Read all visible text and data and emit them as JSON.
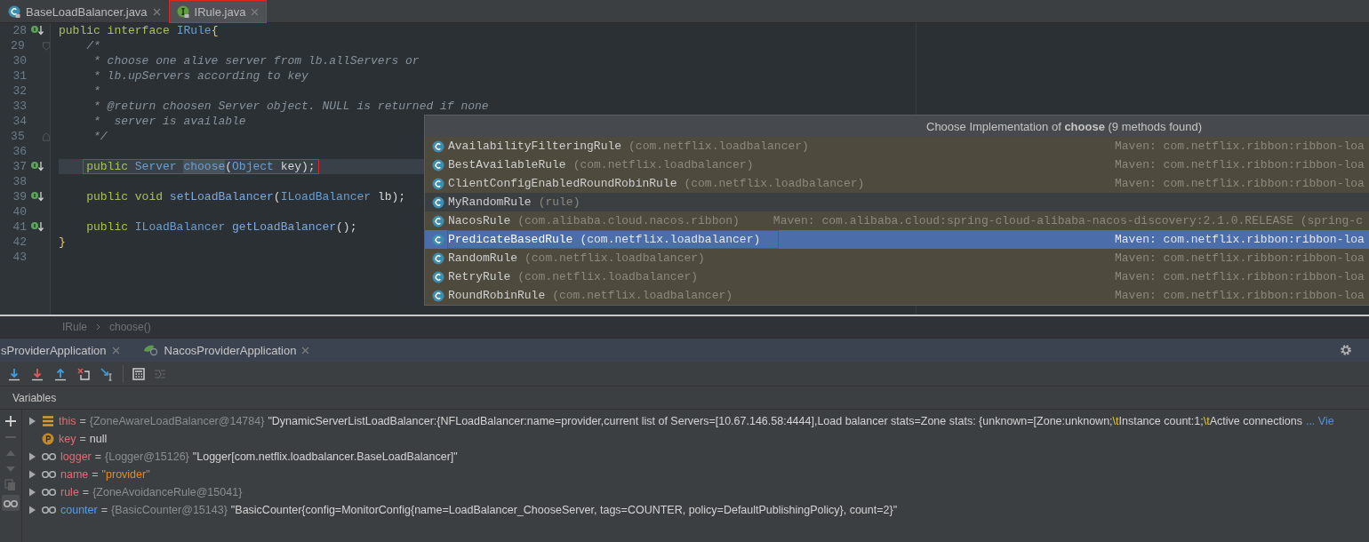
{
  "editor_tabs": [
    {
      "label": "BaseLoadBalancer.java",
      "kind": "class",
      "selected": false,
      "annotated": false
    },
    {
      "label": "IRule.java",
      "kind": "interface",
      "selected": true,
      "annotated": true
    }
  ],
  "code": {
    "lines": [
      {
        "number": "28",
        "kind": "implemented",
        "current": false,
        "annotated": false,
        "tokens": [
          {
            "text": "public interface ",
            "kind": "keyword"
          },
          {
            "text": "IRule",
            "kind": "type"
          },
          {
            "text": "{",
            "kind": "brace"
          }
        ]
      },
      {
        "number": "29",
        "kind": "fold-start",
        "current": false,
        "annotated": false,
        "tokens": [
          {
            "text": "    /*",
            "kind": "comment"
          }
        ]
      },
      {
        "number": "30",
        "kind": "plain",
        "current": false,
        "annotated": false,
        "tokens": [
          {
            "text": "     * choose one alive server from lb.allServers or",
            "kind": "comment"
          }
        ]
      },
      {
        "number": "31",
        "kind": "plain",
        "current": false,
        "annotated": false,
        "tokens": [
          {
            "text": "     * lb.upServers according to key",
            "kind": "comment"
          }
        ]
      },
      {
        "number": "32",
        "kind": "plain",
        "current": false,
        "annotated": false,
        "tokens": [
          {
            "text": "     *",
            "kind": "comment"
          }
        ]
      },
      {
        "number": "33",
        "kind": "plain",
        "current": false,
        "annotated": false,
        "tokens": [
          {
            "text": "     * @return choosen Server object. NULL is returned if none",
            "kind": "comment"
          }
        ]
      },
      {
        "number": "34",
        "kind": "plain",
        "current": false,
        "annotated": false,
        "tokens": [
          {
            "text": "     *  server is available",
            "kind": "comment"
          }
        ]
      },
      {
        "number": "35",
        "kind": "fold-end",
        "current": false,
        "annotated": false,
        "tokens": [
          {
            "text": "     */",
            "kind": "comment"
          }
        ]
      },
      {
        "number": "36",
        "kind": "plain",
        "current": false,
        "annotated": false
      },
      {
        "number": "37",
        "kind": "implemented",
        "current": true,
        "annotated": true,
        "tokens": [
          {
            "text": "    public ",
            "kind": "keyword"
          },
          {
            "text": "Server ",
            "kind": "type"
          },
          {
            "text": "choose",
            "kind": "match"
          },
          {
            "text": "(",
            "kind": "plain"
          },
          {
            "text": "Object ",
            "kind": "type"
          },
          {
            "text": "key);",
            "kind": "plain"
          }
        ]
      },
      {
        "number": "38",
        "kind": "plain",
        "current": false,
        "annotated": false
      },
      {
        "number": "39",
        "kind": "implemented",
        "current": false,
        "annotated": false,
        "tokens": [
          {
            "text": "    public void ",
            "kind": "keyword"
          },
          {
            "text": "setLoadBalancer",
            "kind": "method"
          },
          {
            "text": "(",
            "kind": "plain"
          },
          {
            "text": "ILoadBalancer ",
            "kind": "type"
          },
          {
            "text": "lb);",
            "kind": "plain"
          }
        ]
      },
      {
        "number": "40",
        "kind": "plain",
        "current": false,
        "annotated": false
      },
      {
        "number": "41",
        "kind": "implemented",
        "current": false,
        "annotated": false,
        "tokens": [
          {
            "text": "    public ",
            "kind": "keyword"
          },
          {
            "text": "ILoadBalancer ",
            "kind": "type"
          },
          {
            "text": "getLoadBalancer",
            "kind": "method"
          },
          {
            "text": "();",
            "kind": "plain"
          }
        ]
      },
      {
        "number": "42",
        "kind": "plain",
        "current": false,
        "annotated": false,
        "tokens": [
          {
            "text": "}",
            "kind": "brace"
          }
        ]
      },
      {
        "number": "43",
        "kind": "plain",
        "current": false,
        "annotated": false
      }
    ]
  },
  "implementations_popup": {
    "title": "Choose Implementation of **choose** (9 methods found)",
    "items": [
      {
        "name": "AvailabilityFilteringRule",
        "package": "(com.netflix.loadbalancer)",
        "location": "Maven: com.netflix.ribbon:ribbon-loa",
        "kind": "library",
        "selected": false,
        "annotated": false
      },
      {
        "name": "BestAvailableRule",
        "package": "(com.netflix.loadbalancer)",
        "location": "Maven: com.netflix.ribbon:ribbon-loa",
        "kind": "library",
        "selected": false,
        "annotated": false
      },
      {
        "name": "ClientConfigEnabledRoundRobinRule",
        "package": "(com.netflix.loadbalancer)",
        "location": "Maven: com.netflix.ribbon:ribbon-loa",
        "kind": "library",
        "selected": false,
        "annotated": false
      },
      {
        "name": "MyRandomRule",
        "package": "(rule)",
        "kind": "project",
        "selected": false,
        "annotated": false
      },
      {
        "name": "NacosRule",
        "package": "(com.alibaba.cloud.nacos.ribbon)",
        "location": "Maven: com.alibaba.cloud:spring-cloud-alibaba-nacos-discovery:2.1.0.RELEASE (spring-c",
        "kind": "library",
        "selected": false,
        "annotated": false
      },
      {
        "name": "PredicateBasedRule",
        "package": "(com.netflix.loadbalancer)",
        "location": "Maven: com.netflix.ribbon:ribbon-loa",
        "kind": "library",
        "selected": true,
        "annotated": true
      },
      {
        "name": "RandomRule",
        "package": "(com.netflix.loadbalancer)",
        "location": "Maven: com.netflix.ribbon:ribbon-loa",
        "kind": "library",
        "selected": false,
        "annotated": false
      },
      {
        "name": "RetryRule",
        "package": "(com.netflix.loadbalancer)",
        "location": "Maven: com.netflix.ribbon:ribbon-loa",
        "kind": "library",
        "selected": false,
        "annotated": false
      },
      {
        "name": "RoundRobinRule",
        "package": "(com.netflix.loadbalancer)",
        "location": "Maven: com.netflix.ribbon:ribbon-loa",
        "kind": "library",
        "selected": false,
        "annotated": false
      }
    ]
  },
  "breadcrumb": [
    "IRule",
    "choose()"
  ],
  "debug_tabs": [
    {
      "label": "sProviderApplication",
      "kind": "plain"
    },
    {
      "label": "NacosProviderApplication",
      "kind": "spring"
    }
  ],
  "variables": {
    "title": "Variables",
    "rows": [
      {
        "name": "this",
        "kind": "fields",
        "expandable": true,
        "color": "#e06c75",
        "assign": "=",
        "type": "{ZoneAwareLoadBalancer@14784}",
        "value": [
          {
            "text": "\"DynamicServerListLoadBalancer:{NFLoadBalancer:name=provider,current list of Servers=[10.67.146.58:4444],Load balancer stats=Zone stats: {unknown=[Zone:unknown;",
            "kind": "plain"
          },
          {
            "text": "\\t",
            "kind": "escape"
          },
          {
            "text": "Instance count:1;",
            "kind": "plain"
          },
          {
            "text": "\\t",
            "kind": "escape"
          },
          {
            "text": "Active connections",
            "kind": "plain"
          }
        ],
        "more": "... Vie"
      },
      {
        "name": "key",
        "kind": "param",
        "expandable": false,
        "color": "#e06c75",
        "assign": "=",
        "value": [
          {
            "text": "null",
            "kind": "plain"
          }
        ]
      },
      {
        "name": "logger",
        "kind": "watch",
        "expandable": true,
        "color": "#e06c75",
        "assign": "=",
        "type": "{Logger@15126}",
        "value": [
          {
            "text": "\"Logger[com.netflix.loadbalancer.BaseLoadBalancer]\"",
            "kind": "plain"
          }
        ]
      },
      {
        "name": "name",
        "kind": "watch",
        "expandable": true,
        "color": "#e06c75",
        "assign": "=",
        "value": [
          {
            "text": "\"provider\"",
            "kind": "string"
          }
        ]
      },
      {
        "name": "rule",
        "kind": "watch",
        "expandable": true,
        "color": "#e06c75",
        "assign": "=",
        "type": "{ZoneAvoidanceRule@15041}"
      },
      {
        "name": "counter",
        "kind": "watch",
        "expandable": true,
        "color": "#5a9be6",
        "assign": "=",
        "type": "{BasicCounter@15143}",
        "value": [
          {
            "text": "\"BasicCounter{config=MonitorConfig{name=LoadBalancer_ChooseServer, tags=COUNTER, policy=DefaultPublishingPolicy}, count=2}\"",
            "kind": "plain"
          }
        ]
      }
    ]
  }
}
